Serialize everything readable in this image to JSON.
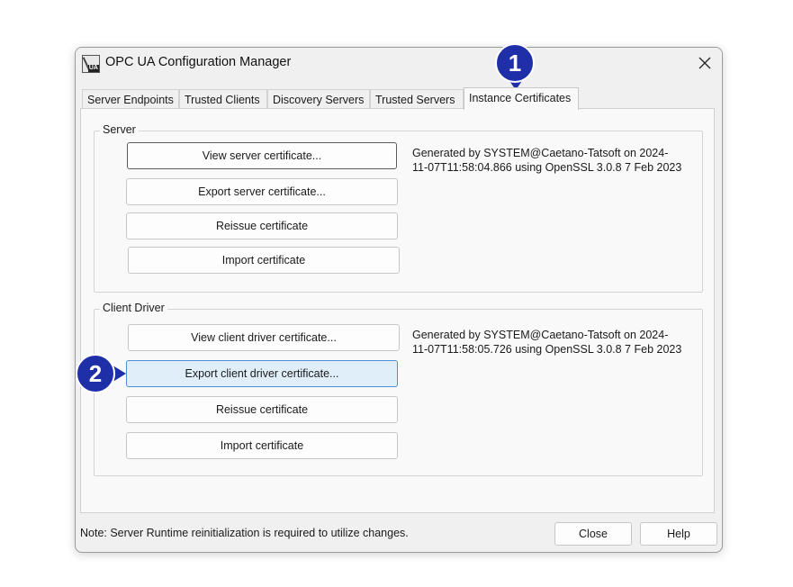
{
  "window": {
    "title": "OPC UA Configuration Manager"
  },
  "tabs": [
    {
      "label": "Server Endpoints"
    },
    {
      "label": "Trusted Clients"
    },
    {
      "label": "Discovery Servers"
    },
    {
      "label": "Trusted Servers"
    },
    {
      "label": "Instance Certificates",
      "active": true
    }
  ],
  "server_group": {
    "label": "Server",
    "buttons": {
      "view": "View server certificate...",
      "export": "Export server certificate...",
      "reissue": "Reissue certificate",
      "import": "Import certificate"
    },
    "info": "Generated by SYSTEM@Caetano-Tatsoft on 2024-11-07T11:58:04.866 using OpenSSL 3.0.8 7 Feb 2023"
  },
  "client_group": {
    "label": "Client Driver",
    "buttons": {
      "view": "View client driver certificate...",
      "export": "Export client driver certificate...",
      "reissue": "Reissue certificate",
      "import": "Import certificate"
    },
    "info": "Generated by SYSTEM@Caetano-Tatsoft on 2024-11-07T11:58:05.726 using OpenSSL 3.0.8 7 Feb 2023"
  },
  "footer": {
    "note": "Note: Server Runtime reinitialization is required to utilize changes.",
    "close_label": "Close",
    "help_label": "Help"
  },
  "callouts": [
    {
      "number": "1"
    },
    {
      "number": "2"
    }
  ],
  "colors": {
    "callout": "#1f2fa8",
    "hover_button": "#e0eef9",
    "hover_border": "#4a90d2"
  }
}
